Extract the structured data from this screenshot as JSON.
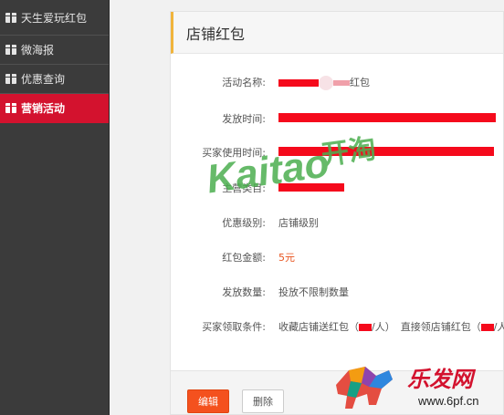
{
  "sidebar": {
    "items": [
      {
        "label": "天生爱玩红包",
        "active": false
      },
      {
        "label": "微海报",
        "active": false
      },
      {
        "label": "优惠查询",
        "active": false
      },
      {
        "label": "营销活动",
        "active": true
      }
    ]
  },
  "panel": {
    "title": "店铺红包",
    "fields": [
      {
        "label": "活动名称:",
        "value": "红包"
      },
      {
        "label": "发放时间:",
        "value": ""
      },
      {
        "label": "买家使用时间:",
        "value": ""
      },
      {
        "label": "主营类目:",
        "value": ""
      },
      {
        "label": "优惠级别:",
        "value": "店铺级别"
      },
      {
        "label": "红包金额:",
        "value": "5元"
      },
      {
        "label": "发放数量:",
        "value": "投放不限制数量"
      },
      {
        "label": "买家领取条件:",
        "value_a": "收藏店铺送红包（",
        "value_b": "/人）",
        "value_c": "直接领店铺红包（",
        "value_d": "/人）"
      }
    ]
  },
  "footer": {
    "edit_label": "编辑",
    "delete_label": "删除"
  },
  "watermarks": {
    "kaitao_latin": "Kaitao",
    "kaitao_cn": "开淘",
    "site_cn": "乐发网",
    "site_url": "www.6pf.cn"
  },
  "colors": {
    "sidebar_bg": "#3b3b3b",
    "active_bg": "#d3122e",
    "accent_orange": "#f4511e",
    "redaction": "#f50a1c",
    "watermark_green": "#4caf50"
  }
}
